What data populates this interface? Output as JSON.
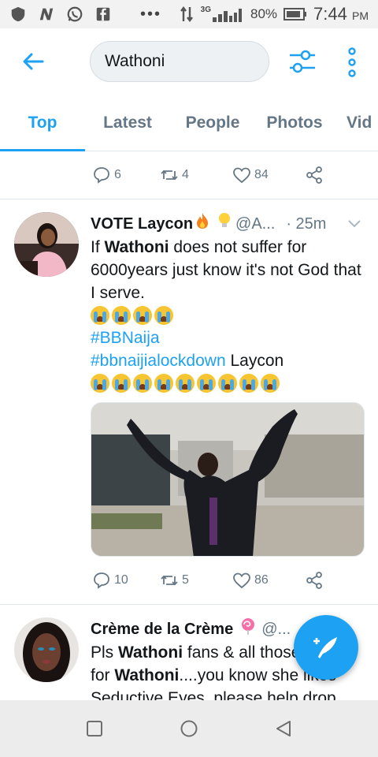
{
  "status_bar": {
    "network": "3G",
    "battery": "80%",
    "time": "7:44",
    "ampm": "PM"
  },
  "header": {
    "search_value": "Wathoni"
  },
  "tabs": [
    {
      "label": "Top",
      "active": true
    },
    {
      "label": "Latest",
      "active": false
    },
    {
      "label": "People",
      "active": false
    },
    {
      "label": "Photos",
      "active": false
    },
    {
      "label": "Vid",
      "active": false
    }
  ],
  "prev_tweet": {
    "replies": "6",
    "retweets": "4",
    "likes": "84"
  },
  "tweet1": {
    "name": "VOTE Laycon",
    "handle": "@A...",
    "time": "· 25m",
    "text_prefix": "If ",
    "text_bold": "Wathoni",
    "text_suffix": " does not suffer for 6000years just know it's not God that I serve.",
    "hashtag1": "#BBNaija",
    "hashtag2": "#bbnaijialockdown",
    "after_hashtag2": " Laycon",
    "replies": "10",
    "retweets": "5",
    "likes": "86"
  },
  "tweet2": {
    "name": "Crème de la Crème",
    "handle": "@...",
    "line1_prefix": "Pls ",
    "line1_bold": "Wathoni",
    "line1_suffix": " fans & all those",
    "line2_prefix": "for ",
    "line2_bold": "Wathoni",
    "line2_suffix": "....you know she likes",
    "line3": "Seductive Eyes, please help drop"
  },
  "colors": {
    "accent": "#1da1f2",
    "text_secondary": "#657786"
  }
}
